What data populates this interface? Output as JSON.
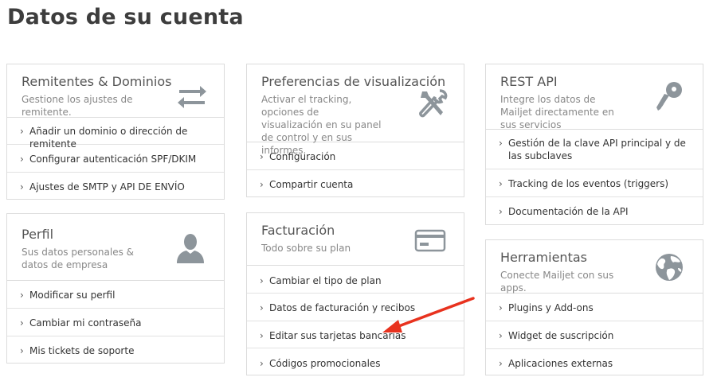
{
  "page_title": "Datos de su cuenta",
  "cards": {
    "senders": {
      "title": "Remitentes & Dominios",
      "description": "Gestione los ajustes de remitente.",
      "icon": "transfer-arrows-icon",
      "items": [
        "Añadir un dominio o dirección de remitente",
        "Configurar autenticación SPF/DKIM",
        "Ajustes de SMTP y API DE ENVÍO"
      ]
    },
    "profile": {
      "title": "Perfil",
      "description": "Sus datos personales & datos de empresa",
      "icon": "user-silhouette-icon",
      "items": [
        "Modificar su perfil",
        "Cambiar mi contraseña",
        "Mis tickets de soporte"
      ]
    },
    "display": {
      "title": "Preferencias de visualización",
      "description": "Activar el tracking, opciones de visualización en su panel de control y en sus informes.",
      "icon": "tools-icon",
      "items": [
        "Configuración",
        "Compartir cuenta"
      ]
    },
    "billing": {
      "title": "Facturación",
      "description": "Todo sobre su plan",
      "icon": "credit-card-icon",
      "items": [
        "Cambiar el tipo de plan",
        "Datos de facturación y recibos",
        "Editar sus tarjetas bancarias",
        "Códigos promocionales"
      ]
    },
    "rest_api": {
      "title": "REST API",
      "description": "Integre los datos de Mailjet directamente en sus servicios",
      "icon": "key-icon",
      "items": [
        "Gestión de la clave API principal y de las subclaves",
        "Tracking de los eventos (triggers)",
        "Documentación de la API"
      ]
    },
    "tools": {
      "title": "Herramientas",
      "description": "Conecte Mailjet con sus apps.",
      "icon": "globe-icon",
      "items": [
        "Plugins y Add-ons",
        "Widget de suscripción",
        "Aplicaciones externas"
      ]
    }
  },
  "annotation": {
    "color": "#e8321e",
    "icon": "red-arrow-annotation"
  },
  "chevron": "›"
}
